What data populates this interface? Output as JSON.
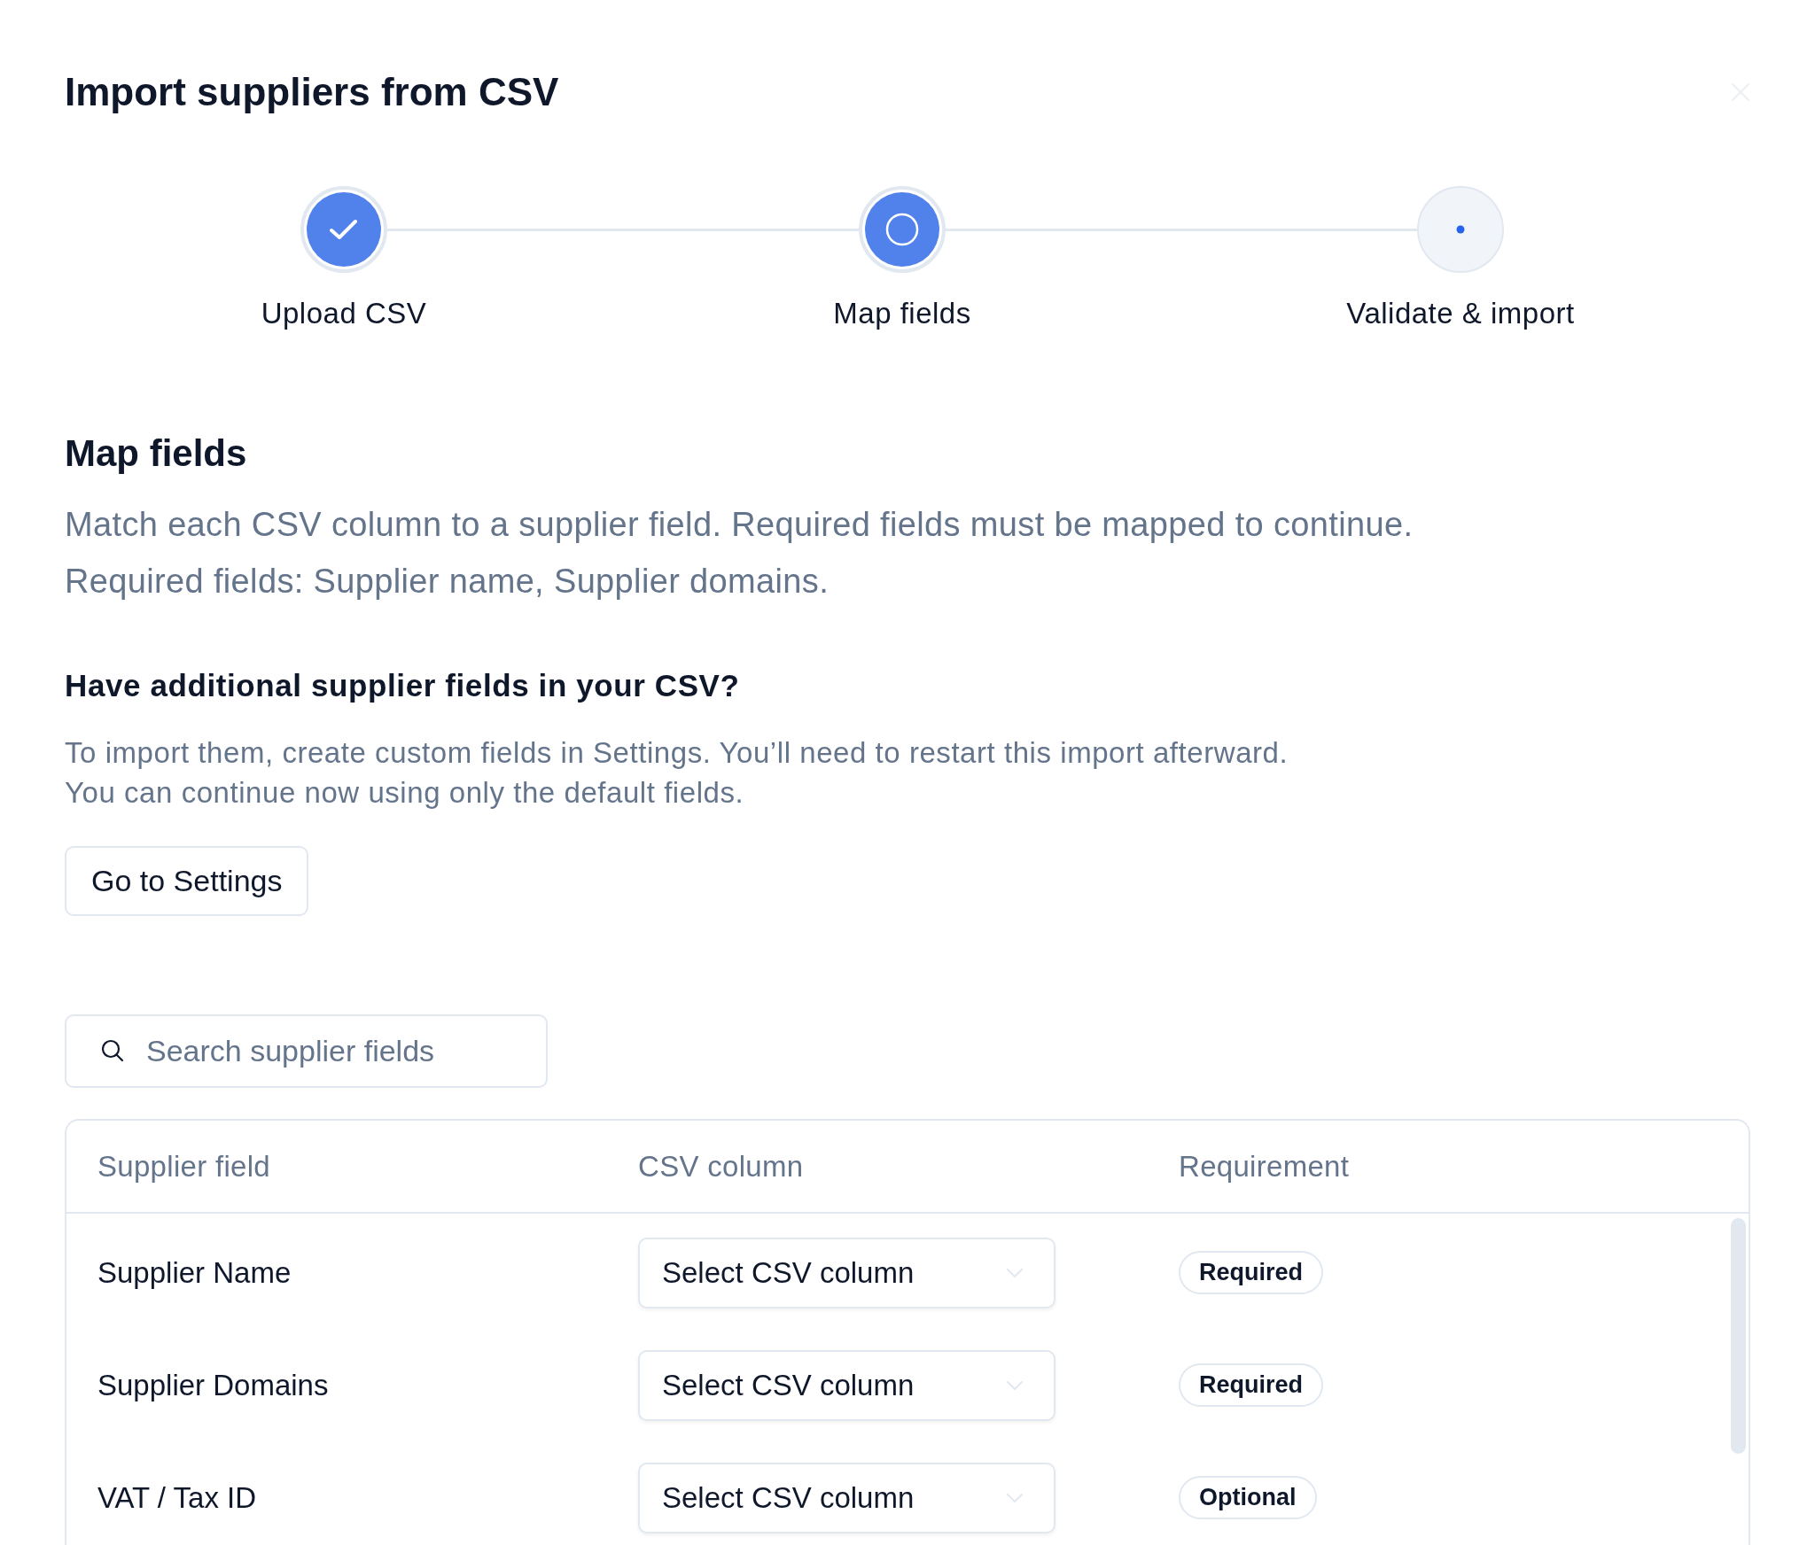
{
  "dialog": {
    "title": "Import suppliers from CSV"
  },
  "steps": [
    {
      "label": "Upload CSV",
      "kind": "completed"
    },
    {
      "label": "Map fields",
      "kind": "current"
    },
    {
      "label": "Validate & import",
      "kind": "upcoming"
    }
  ],
  "map_fields": {
    "heading": "Map fields",
    "description": [
      "Match each CSV column to a supplier field. Required fields must be mapped to continue.",
      "Required fields: Supplier name, Supplier domains."
    ]
  },
  "custom_fields": {
    "heading": "Have additional supplier fields in your CSV?",
    "text": [
      "To import them, create custom fields in Settings. You’ll need to restart this import afterward.",
      "You can continue now using only the default fields."
    ],
    "button": "Go to Settings"
  },
  "search": {
    "placeholder": "Search supplier fields"
  },
  "table": {
    "columns": [
      "Supplier field",
      "CSV column",
      "Requirement"
    ],
    "rows": [
      {
        "supplier_field": "Supplier Name",
        "csv_column": "Select CSV column",
        "requirement": "Required"
      },
      {
        "supplier_field": "Supplier Domains",
        "csv_column": "Select CSV column",
        "requirement": "Required"
      },
      {
        "supplier_field": "VAT / Tax ID",
        "csv_column": "Select CSV column",
        "requirement": "Optional"
      }
    ]
  }
}
